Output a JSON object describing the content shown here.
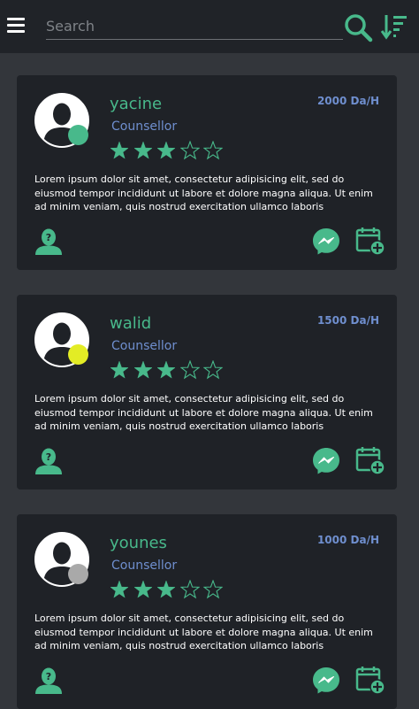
{
  "search": {
    "placeholder": "Search"
  },
  "colors": {
    "accent": "#48b98b",
    "secondary": "#6f8fcf",
    "card_bg": "#1f2227",
    "page_bg": "#33363b"
  },
  "icons": {
    "menu": "hamburger-icon",
    "search": "search-icon",
    "sort": "sort-descending-icon",
    "advisor": "person-question-icon",
    "chat": "messenger-icon",
    "booking": "calendar-add-icon"
  },
  "counsellors": [
    {
      "name": "yacine",
      "role": "Counsellor",
      "price": "2000 Da/H",
      "rating": 3,
      "max_rating": 5,
      "status_color": "#48b98b",
      "description": "Lorem ipsum dolor sit amet, consectetur adipisicing elit, sed do eiusmod tempor incididunt ut labore et dolore magna aliqua. Ut enim ad minim veniam, quis nostrud exercitation ullamco laboris"
    },
    {
      "name": "walid",
      "role": "Counsellor",
      "price": "1500 Da/H",
      "rating": 3,
      "max_rating": 5,
      "status_color": "#e3ec25",
      "description": "Lorem ipsum dolor sit amet, consectetur adipisicing elit, sed do eiusmod tempor incididunt ut labore et dolore magna aliqua. Ut enim ad minim veniam, quis nostrud exercitation ullamco laboris"
    },
    {
      "name": "younes",
      "role": "Counsellor",
      "price": "1000 Da/H",
      "rating": 3,
      "max_rating": 5,
      "status_color": "#a9a9a9",
      "description": "Lorem ipsum dolor sit amet, consectetur adipisicing elit, sed do eiusmod tempor incididunt ut labore et dolore magna aliqua. Ut enim ad minim veniam, quis nostrud exercitation ullamco laboris"
    }
  ]
}
